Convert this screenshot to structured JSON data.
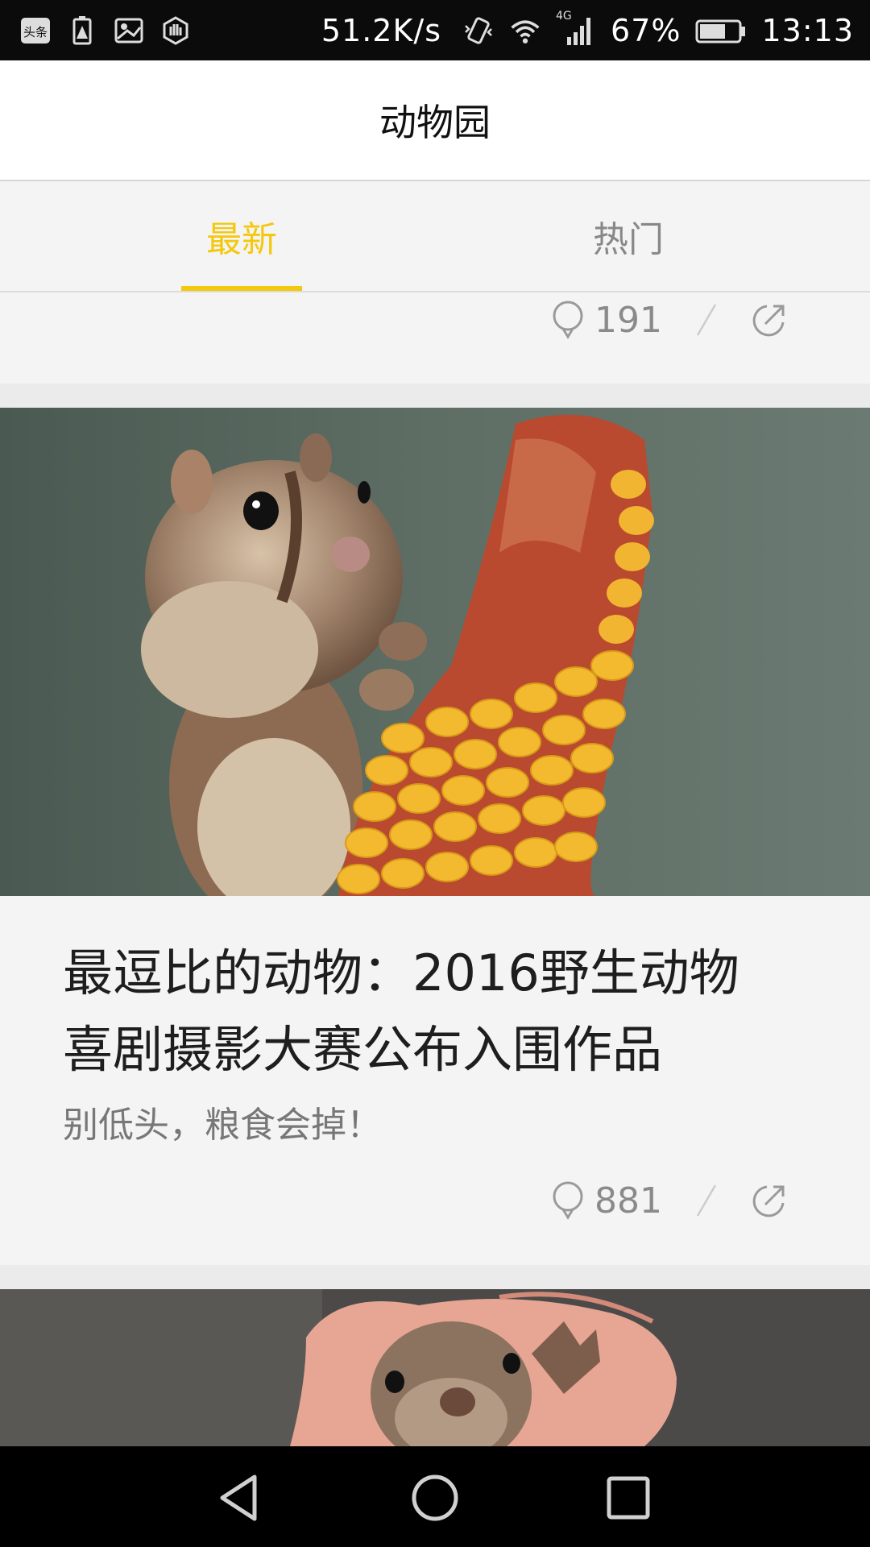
{
  "status_bar": {
    "left_icons": [
      "toutiao-app-icon",
      "battery-warning-icon",
      "image-icon",
      "hand-icon"
    ],
    "toutiao_label": "头条",
    "net_speed": "51.2K/s",
    "network_type": "4G",
    "battery_percent": "67%",
    "battery_level": 0.67,
    "time": "13:13"
  },
  "header": {
    "title": "动物园"
  },
  "tabs": [
    {
      "label": "最新",
      "active": true
    },
    {
      "label": "热门",
      "active": false
    }
  ],
  "colors": {
    "accent": "#f4c80e",
    "background": "#f4f4f4"
  },
  "feed": [
    {
      "comments": "191"
    },
    {
      "image": "chipmunk-with-corn-photo",
      "title": "最逗比的动物：2016野生动物喜剧摄影大赛公布入围作品",
      "subtitle": "别低头，粮食会掉！",
      "comments": "881"
    },
    {
      "image": "squirrel-in-hand-photo"
    }
  ],
  "nav_bar": [
    "back-icon",
    "home-icon",
    "recent-apps-icon"
  ]
}
